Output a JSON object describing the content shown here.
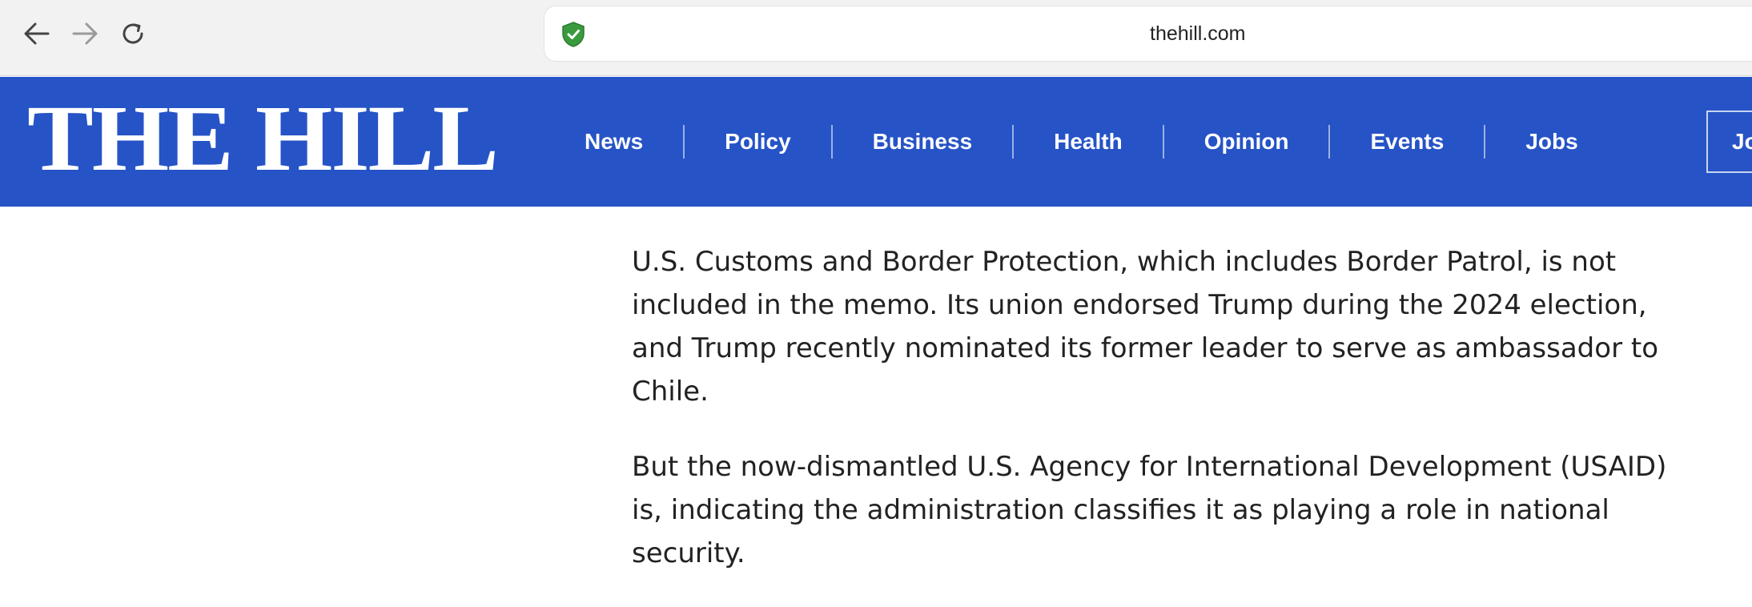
{
  "browser": {
    "url": "thehill.com",
    "icons": {
      "back": "arrow-left-icon",
      "forward": "arrow-right-icon",
      "reload": "reload-icon",
      "security": "shield-check-icon"
    }
  },
  "site": {
    "logo": "THE HILL",
    "brand_color": "#2653c6",
    "nav": [
      "News",
      "Policy",
      "Business",
      "Health",
      "Opinion",
      "Events",
      "Jobs"
    ],
    "join_label": "Jo"
  },
  "article": {
    "paragraphs": [
      "U.S. Customs and Border Protection, which includes Border Patrol, is not included in the memo. Its union endorsed Trump during the 2024 election, and Trump recently nominated its former leader to serve as ambassador to Chile.",
      "But the now-dismantled U.S. Agency for International Development (USAID) is, indicating the administration classifies it as playing a role in national security."
    ]
  }
}
